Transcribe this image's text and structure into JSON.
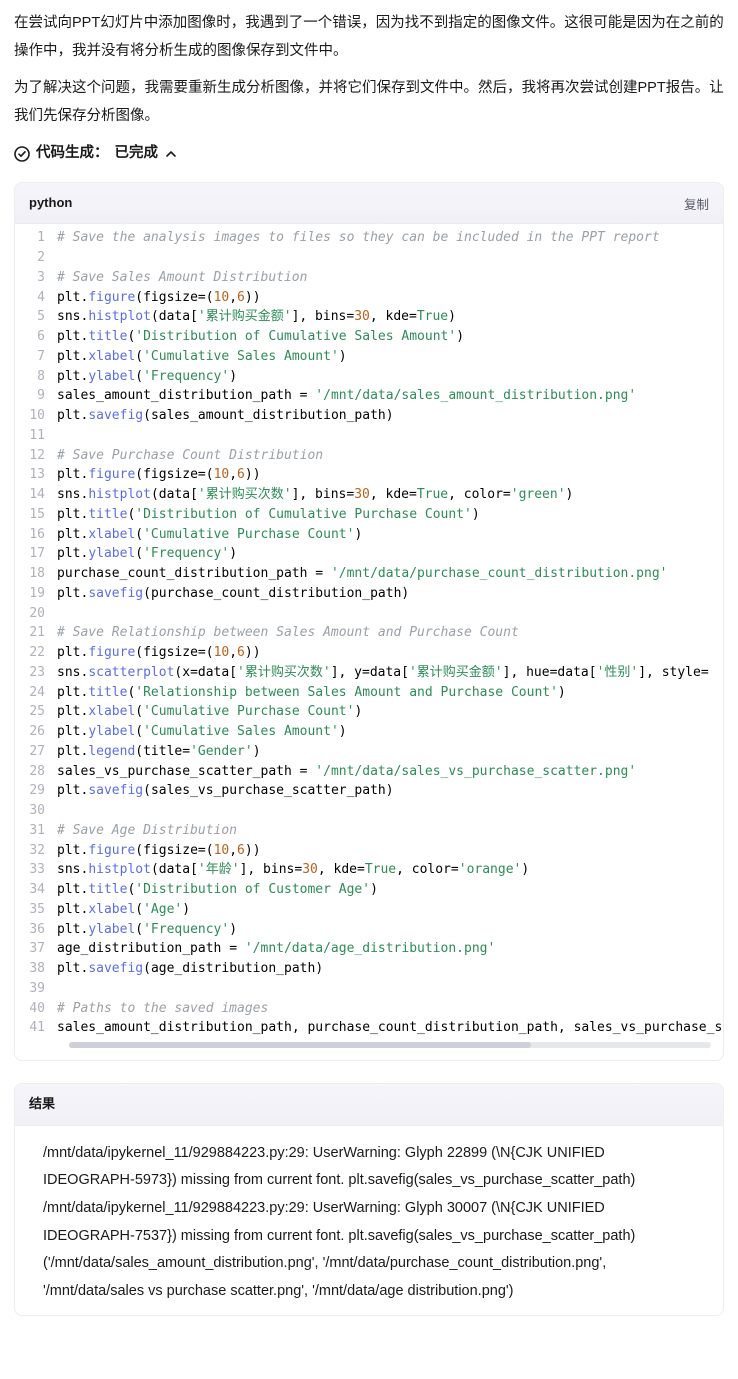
{
  "prose": {
    "p1": "在尝试向PPT幻灯片中添加图像时，我遇到了一个错误，因为找不到指定的图像文件。这很可能是因为在之前的操作中，我并没有将分析生成的图像保存到文件中。",
    "p2": "为了解决这个问题，我需要重新生成分析图像，并将它们保存到文件中。然后，我将再次尝试创建PPT报告。让我们先保存分析图像。"
  },
  "status": {
    "label_prefix": "代码生成：",
    "label_state": "已完成"
  },
  "code": {
    "language": "python",
    "copy_label": "复制",
    "lines": [
      [
        {
          "t": "comment",
          "v": "# Save the analysis images to files so they can be included in the PPT report"
        }
      ],
      [],
      [
        {
          "t": "comment",
          "v": "# Save Sales Amount Distribution"
        }
      ],
      [
        {
          "t": "ident",
          "v": "plt"
        },
        {
          "t": "punct",
          "v": "."
        },
        {
          "t": "func",
          "v": "figure"
        },
        {
          "t": "punct",
          "v": "("
        },
        {
          "t": "kwarg",
          "v": "figsize"
        },
        {
          "t": "punct",
          "v": "=("
        },
        {
          "t": "num",
          "v": "10"
        },
        {
          "t": "punct",
          "v": ","
        },
        {
          "t": "num",
          "v": "6"
        },
        {
          "t": "punct",
          "v": "))"
        }
      ],
      [
        {
          "t": "ident",
          "v": "sns"
        },
        {
          "t": "punct",
          "v": "."
        },
        {
          "t": "func",
          "v": "histplot"
        },
        {
          "t": "punct",
          "v": "("
        },
        {
          "t": "ident",
          "v": "data"
        },
        {
          "t": "punct",
          "v": "["
        },
        {
          "t": "str",
          "v": "'累计购买金额'"
        },
        {
          "t": "punct",
          "v": "], "
        },
        {
          "t": "kwarg",
          "v": "bins"
        },
        {
          "t": "punct",
          "v": "="
        },
        {
          "t": "num",
          "v": "30"
        },
        {
          "t": "punct",
          "v": ", "
        },
        {
          "t": "kwarg",
          "v": "kde"
        },
        {
          "t": "punct",
          "v": "="
        },
        {
          "t": "bool",
          "v": "True"
        },
        {
          "t": "punct",
          "v": ")"
        }
      ],
      [
        {
          "t": "ident",
          "v": "plt"
        },
        {
          "t": "punct",
          "v": "."
        },
        {
          "t": "func",
          "v": "title"
        },
        {
          "t": "punct",
          "v": "("
        },
        {
          "t": "str",
          "v": "'Distribution of Cumulative Sales Amount'"
        },
        {
          "t": "punct",
          "v": ")"
        }
      ],
      [
        {
          "t": "ident",
          "v": "plt"
        },
        {
          "t": "punct",
          "v": "."
        },
        {
          "t": "func",
          "v": "xlabel"
        },
        {
          "t": "punct",
          "v": "("
        },
        {
          "t": "str",
          "v": "'Cumulative Sales Amount'"
        },
        {
          "t": "punct",
          "v": ")"
        }
      ],
      [
        {
          "t": "ident",
          "v": "plt"
        },
        {
          "t": "punct",
          "v": "."
        },
        {
          "t": "func",
          "v": "ylabel"
        },
        {
          "t": "punct",
          "v": "("
        },
        {
          "t": "str",
          "v": "'Frequency'"
        },
        {
          "t": "punct",
          "v": ")"
        }
      ],
      [
        {
          "t": "ident",
          "v": "sales_amount_distribution_path "
        },
        {
          "t": "punct",
          "v": "= "
        },
        {
          "t": "str",
          "v": "'/mnt/data/sales_amount_distribution.png'"
        }
      ],
      [
        {
          "t": "ident",
          "v": "plt"
        },
        {
          "t": "punct",
          "v": "."
        },
        {
          "t": "func",
          "v": "savefig"
        },
        {
          "t": "punct",
          "v": "("
        },
        {
          "t": "ident",
          "v": "sales_amount_distribution_path"
        },
        {
          "t": "punct",
          "v": ")"
        }
      ],
      [],
      [
        {
          "t": "comment",
          "v": "# Save Purchase Count Distribution"
        }
      ],
      [
        {
          "t": "ident",
          "v": "plt"
        },
        {
          "t": "punct",
          "v": "."
        },
        {
          "t": "func",
          "v": "figure"
        },
        {
          "t": "punct",
          "v": "("
        },
        {
          "t": "kwarg",
          "v": "figsize"
        },
        {
          "t": "punct",
          "v": "=("
        },
        {
          "t": "num",
          "v": "10"
        },
        {
          "t": "punct",
          "v": ","
        },
        {
          "t": "num",
          "v": "6"
        },
        {
          "t": "punct",
          "v": "))"
        }
      ],
      [
        {
          "t": "ident",
          "v": "sns"
        },
        {
          "t": "punct",
          "v": "."
        },
        {
          "t": "func",
          "v": "histplot"
        },
        {
          "t": "punct",
          "v": "("
        },
        {
          "t": "ident",
          "v": "data"
        },
        {
          "t": "punct",
          "v": "["
        },
        {
          "t": "str",
          "v": "'累计购买次数'"
        },
        {
          "t": "punct",
          "v": "], "
        },
        {
          "t": "kwarg",
          "v": "bins"
        },
        {
          "t": "punct",
          "v": "="
        },
        {
          "t": "num",
          "v": "30"
        },
        {
          "t": "punct",
          "v": ", "
        },
        {
          "t": "kwarg",
          "v": "kde"
        },
        {
          "t": "punct",
          "v": "="
        },
        {
          "t": "bool",
          "v": "True"
        },
        {
          "t": "punct",
          "v": ", "
        },
        {
          "t": "kwarg",
          "v": "color"
        },
        {
          "t": "punct",
          "v": "="
        },
        {
          "t": "str",
          "v": "'green'"
        },
        {
          "t": "punct",
          "v": ")"
        }
      ],
      [
        {
          "t": "ident",
          "v": "plt"
        },
        {
          "t": "punct",
          "v": "."
        },
        {
          "t": "func",
          "v": "title"
        },
        {
          "t": "punct",
          "v": "("
        },
        {
          "t": "str",
          "v": "'Distribution of Cumulative Purchase Count'"
        },
        {
          "t": "punct",
          "v": ")"
        }
      ],
      [
        {
          "t": "ident",
          "v": "plt"
        },
        {
          "t": "punct",
          "v": "."
        },
        {
          "t": "func",
          "v": "xlabel"
        },
        {
          "t": "punct",
          "v": "("
        },
        {
          "t": "str",
          "v": "'Cumulative Purchase Count'"
        },
        {
          "t": "punct",
          "v": ")"
        }
      ],
      [
        {
          "t": "ident",
          "v": "plt"
        },
        {
          "t": "punct",
          "v": "."
        },
        {
          "t": "func",
          "v": "ylabel"
        },
        {
          "t": "punct",
          "v": "("
        },
        {
          "t": "str",
          "v": "'Frequency'"
        },
        {
          "t": "punct",
          "v": ")"
        }
      ],
      [
        {
          "t": "ident",
          "v": "purchase_count_distribution_path "
        },
        {
          "t": "punct",
          "v": "= "
        },
        {
          "t": "str",
          "v": "'/mnt/data/purchase_count_distribution.png'"
        }
      ],
      [
        {
          "t": "ident",
          "v": "plt"
        },
        {
          "t": "punct",
          "v": "."
        },
        {
          "t": "func",
          "v": "savefig"
        },
        {
          "t": "punct",
          "v": "("
        },
        {
          "t": "ident",
          "v": "purchase_count_distribution_path"
        },
        {
          "t": "punct",
          "v": ")"
        }
      ],
      [],
      [
        {
          "t": "comment",
          "v": "# Save Relationship between Sales Amount and Purchase Count"
        }
      ],
      [
        {
          "t": "ident",
          "v": "plt"
        },
        {
          "t": "punct",
          "v": "."
        },
        {
          "t": "func",
          "v": "figure"
        },
        {
          "t": "punct",
          "v": "("
        },
        {
          "t": "kwarg",
          "v": "figsize"
        },
        {
          "t": "punct",
          "v": "=("
        },
        {
          "t": "num",
          "v": "10"
        },
        {
          "t": "punct",
          "v": ","
        },
        {
          "t": "num",
          "v": "6"
        },
        {
          "t": "punct",
          "v": "))"
        }
      ],
      [
        {
          "t": "ident",
          "v": "sns"
        },
        {
          "t": "punct",
          "v": "."
        },
        {
          "t": "func",
          "v": "scatterplot"
        },
        {
          "t": "punct",
          "v": "("
        },
        {
          "t": "kwarg",
          "v": "x"
        },
        {
          "t": "punct",
          "v": "="
        },
        {
          "t": "ident",
          "v": "data"
        },
        {
          "t": "punct",
          "v": "["
        },
        {
          "t": "str",
          "v": "'累计购买次数'"
        },
        {
          "t": "punct",
          "v": "], "
        },
        {
          "t": "kwarg",
          "v": "y"
        },
        {
          "t": "punct",
          "v": "="
        },
        {
          "t": "ident",
          "v": "data"
        },
        {
          "t": "punct",
          "v": "["
        },
        {
          "t": "str",
          "v": "'累计购买金额'"
        },
        {
          "t": "punct",
          "v": "], "
        },
        {
          "t": "kwarg",
          "v": "hue"
        },
        {
          "t": "punct",
          "v": "="
        },
        {
          "t": "ident",
          "v": "data"
        },
        {
          "t": "punct",
          "v": "["
        },
        {
          "t": "str",
          "v": "'性别'"
        },
        {
          "t": "punct",
          "v": "], "
        },
        {
          "t": "kwarg",
          "v": "style"
        },
        {
          "t": "punct",
          "v": "="
        }
      ],
      [
        {
          "t": "ident",
          "v": "plt"
        },
        {
          "t": "punct",
          "v": "."
        },
        {
          "t": "func",
          "v": "title"
        },
        {
          "t": "punct",
          "v": "("
        },
        {
          "t": "str",
          "v": "'Relationship between Sales Amount and Purchase Count'"
        },
        {
          "t": "punct",
          "v": ")"
        }
      ],
      [
        {
          "t": "ident",
          "v": "plt"
        },
        {
          "t": "punct",
          "v": "."
        },
        {
          "t": "func",
          "v": "xlabel"
        },
        {
          "t": "punct",
          "v": "("
        },
        {
          "t": "str",
          "v": "'Cumulative Purchase Count'"
        },
        {
          "t": "punct",
          "v": ")"
        }
      ],
      [
        {
          "t": "ident",
          "v": "plt"
        },
        {
          "t": "punct",
          "v": "."
        },
        {
          "t": "func",
          "v": "ylabel"
        },
        {
          "t": "punct",
          "v": "("
        },
        {
          "t": "str",
          "v": "'Cumulative Sales Amount'"
        },
        {
          "t": "punct",
          "v": ")"
        }
      ],
      [
        {
          "t": "ident",
          "v": "plt"
        },
        {
          "t": "punct",
          "v": "."
        },
        {
          "t": "func",
          "v": "legend"
        },
        {
          "t": "punct",
          "v": "("
        },
        {
          "t": "kwarg",
          "v": "title"
        },
        {
          "t": "punct",
          "v": "="
        },
        {
          "t": "str",
          "v": "'Gender'"
        },
        {
          "t": "punct",
          "v": ")"
        }
      ],
      [
        {
          "t": "ident",
          "v": "sales_vs_purchase_scatter_path "
        },
        {
          "t": "punct",
          "v": "= "
        },
        {
          "t": "str",
          "v": "'/mnt/data/sales_vs_purchase_scatter.png'"
        }
      ],
      [
        {
          "t": "ident",
          "v": "plt"
        },
        {
          "t": "punct",
          "v": "."
        },
        {
          "t": "func",
          "v": "savefig"
        },
        {
          "t": "punct",
          "v": "("
        },
        {
          "t": "ident",
          "v": "sales_vs_purchase_scatter_path"
        },
        {
          "t": "punct",
          "v": ")"
        }
      ],
      [],
      [
        {
          "t": "comment",
          "v": "# Save Age Distribution"
        }
      ],
      [
        {
          "t": "ident",
          "v": "plt"
        },
        {
          "t": "punct",
          "v": "."
        },
        {
          "t": "func",
          "v": "figure"
        },
        {
          "t": "punct",
          "v": "("
        },
        {
          "t": "kwarg",
          "v": "figsize"
        },
        {
          "t": "punct",
          "v": "=("
        },
        {
          "t": "num",
          "v": "10"
        },
        {
          "t": "punct",
          "v": ","
        },
        {
          "t": "num",
          "v": "6"
        },
        {
          "t": "punct",
          "v": "))"
        }
      ],
      [
        {
          "t": "ident",
          "v": "sns"
        },
        {
          "t": "punct",
          "v": "."
        },
        {
          "t": "func",
          "v": "histplot"
        },
        {
          "t": "punct",
          "v": "("
        },
        {
          "t": "ident",
          "v": "data"
        },
        {
          "t": "punct",
          "v": "["
        },
        {
          "t": "str",
          "v": "'年龄'"
        },
        {
          "t": "punct",
          "v": "], "
        },
        {
          "t": "kwarg",
          "v": "bins"
        },
        {
          "t": "punct",
          "v": "="
        },
        {
          "t": "num",
          "v": "30"
        },
        {
          "t": "punct",
          "v": ", "
        },
        {
          "t": "kwarg",
          "v": "kde"
        },
        {
          "t": "punct",
          "v": "="
        },
        {
          "t": "bool",
          "v": "True"
        },
        {
          "t": "punct",
          "v": ", "
        },
        {
          "t": "kwarg",
          "v": "color"
        },
        {
          "t": "punct",
          "v": "="
        },
        {
          "t": "str",
          "v": "'orange'"
        },
        {
          "t": "punct",
          "v": ")"
        }
      ],
      [
        {
          "t": "ident",
          "v": "plt"
        },
        {
          "t": "punct",
          "v": "."
        },
        {
          "t": "func",
          "v": "title"
        },
        {
          "t": "punct",
          "v": "("
        },
        {
          "t": "str",
          "v": "'Distribution of Customer Age'"
        },
        {
          "t": "punct",
          "v": ")"
        }
      ],
      [
        {
          "t": "ident",
          "v": "plt"
        },
        {
          "t": "punct",
          "v": "."
        },
        {
          "t": "func",
          "v": "xlabel"
        },
        {
          "t": "punct",
          "v": "("
        },
        {
          "t": "str",
          "v": "'Age'"
        },
        {
          "t": "punct",
          "v": ")"
        }
      ],
      [
        {
          "t": "ident",
          "v": "plt"
        },
        {
          "t": "punct",
          "v": "."
        },
        {
          "t": "func",
          "v": "ylabel"
        },
        {
          "t": "punct",
          "v": "("
        },
        {
          "t": "str",
          "v": "'Frequency'"
        },
        {
          "t": "punct",
          "v": ")"
        }
      ],
      [
        {
          "t": "ident",
          "v": "age_distribution_path "
        },
        {
          "t": "punct",
          "v": "= "
        },
        {
          "t": "str",
          "v": "'/mnt/data/age_distribution.png'"
        }
      ],
      [
        {
          "t": "ident",
          "v": "plt"
        },
        {
          "t": "punct",
          "v": "."
        },
        {
          "t": "func",
          "v": "savefig"
        },
        {
          "t": "punct",
          "v": "("
        },
        {
          "t": "ident",
          "v": "age_distribution_path"
        },
        {
          "t": "punct",
          "v": ")"
        }
      ],
      [],
      [
        {
          "t": "comment",
          "v": "# Paths to the saved images"
        }
      ],
      [
        {
          "t": "ident",
          "v": "sales_amount_distribution_path"
        },
        {
          "t": "punct",
          "v": ", "
        },
        {
          "t": "ident",
          "v": "purchase_count_distribution_path"
        },
        {
          "t": "punct",
          "v": ", "
        },
        {
          "t": "ident",
          "v": "sales_vs_purchase_s"
        }
      ]
    ]
  },
  "result": {
    "header": "结果",
    "lines": [
      "/mnt/data/ipykernel_11/929884223.py:29: UserWarning: Glyph 22899 (\\N{CJK UNIFIED IDEOGRAPH-5973}) missing from current font. plt.savefig(sales_vs_purchase_scatter_path)",
      "/mnt/data/ipykernel_11/929884223.py:29: UserWarning: Glyph 30007 (\\N{CJK UNIFIED IDEOGRAPH-7537}) missing from current font. plt.savefig(sales_vs_purchase_scatter_path)",
      "('/mnt/data/sales_amount_distribution.png', '/mnt/data/purchase_count_distribution.png', '/mnt/data/sales vs purchase scatter.png', '/mnt/data/age distribution.png')"
    ]
  }
}
